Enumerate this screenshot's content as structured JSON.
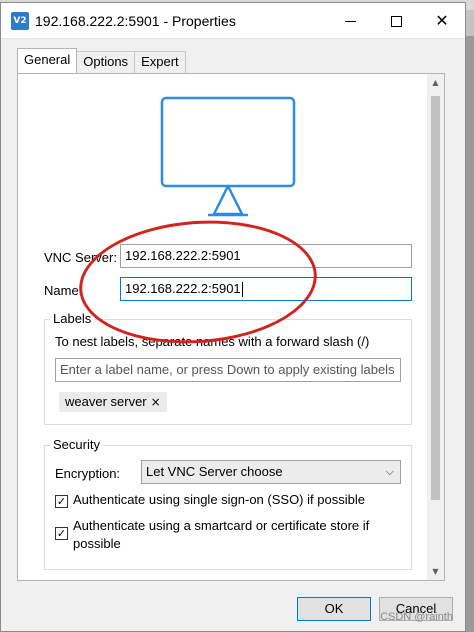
{
  "window": {
    "title": "192.168.222.2:5901 - Properties",
    "icon_text": "V2"
  },
  "tabs": [
    {
      "label": "General",
      "active": true
    },
    {
      "label": "Options",
      "active": false
    },
    {
      "label": "Expert",
      "active": false
    }
  ],
  "form": {
    "vnc_server_label": "VNC Server:",
    "vnc_server_value": "192.168.222.2:5901",
    "name_label": "Name:",
    "name_value": "192.168.222.2:5901"
  },
  "labels_group": {
    "title": "Labels",
    "hint": "To nest labels, separate names with a forward slash (/)",
    "input_placeholder": "Enter a label name, or press Down to apply existing labels",
    "chips": [
      {
        "text": "weaver server",
        "remove_icon": "×"
      }
    ]
  },
  "security_group": {
    "title": "Security",
    "encryption_label": "Encryption:",
    "encryption_value": "Let VNC Server choose",
    "sso_label": "Authenticate using single sign-on (SSO) if possible",
    "sso_checked": true,
    "smartcard_label_line1": "Authenticate using a smartcard or certificate store if",
    "smartcard_label_line2": "possible",
    "smartcard_checked": true
  },
  "buttons": {
    "ok": "OK",
    "cancel": "Cancel"
  },
  "watermark": "CSDN @rainth",
  "colors": {
    "accent": "#0078d7",
    "monitor_icon": "#2c8be8",
    "annotation": "#d0241e"
  }
}
